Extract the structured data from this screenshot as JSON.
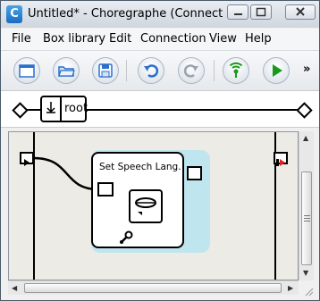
{
  "window": {
    "title": "Untitled* - Choregraphe (Connected to...",
    "app_icon_letter": "C",
    "controls": [
      "minimize-icon",
      "maximize-icon",
      "close-icon"
    ]
  },
  "menu": {
    "items": [
      "File",
      "Box library",
      "Edit",
      "Connection",
      "View",
      "Help"
    ]
  },
  "toolbar": {
    "buttons": [
      "new-window-icon",
      "open-folder-icon",
      "save-icon",
      "undo-icon",
      "redo-icon",
      "connect-wifi-icon",
      "play-icon"
    ],
    "more_label": "»",
    "colors": {
      "play": "#1a9a1a",
      "wifi": "#1a9a1a",
      "accent": "#2a6fcc"
    }
  },
  "breadcrumb": {
    "label": "root"
  },
  "canvas": {
    "box": {
      "title": "Set Speech Lang.",
      "icon": "speech-lips-icon",
      "settings_icon": "wrench-icon",
      "highlight_color": "#bfe6ef"
    },
    "background": "#ecebe5"
  }
}
